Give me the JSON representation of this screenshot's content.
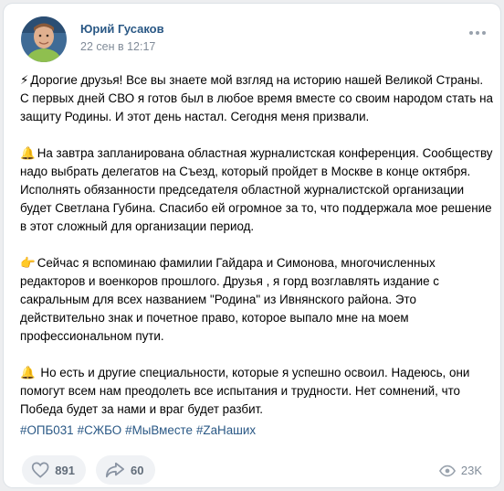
{
  "post": {
    "author": "Юрий Гусаков",
    "date": "22 сен в 12:17",
    "paragraphs": [
      {
        "icon": "⚡",
        "lines": [
          "Дорогие друзья! Все вы знаете мой взгляд на историю нашей Великой Страны.",
          "С первых дней СВО я готов был в любое время вместе со своим народом стать на",
          "защиту Родины. И этот день настал. Сегодня меня призвали."
        ]
      },
      {
        "icon": "🔔",
        "lines": [
          "На завтра запланирована областная журналистская конференция. Сообществу",
          "надо выбрать делегатов на Съезд, который пройдет в Москве в конце октября.",
          "Исполнять обязанности председателя областной журналистской организации",
          "будет Светлана Губина. Спасибо ей огромное за то, что поддержала мое решение",
          "в этот сложный для организации период."
        ]
      },
      {
        "icon": "👉",
        "lines": [
          "Сейчас я вспоминаю фамилии Гайдара и Симонова, многочисленных",
          "редакторов и военкоров прошлого. Друзья , я горд возглавлять издание с",
          "сакральным для всех названием \"Родина\" из Ивнянского района. Это",
          "действительно знак и почетное право, которое выпало мне на моем",
          "профессиональном пути."
        ]
      },
      {
        "icon": "🔔",
        "lines": [
          " Но есть и другие специальности, которые я успешно освоил. Надеюсь, они",
          "помогут всем нам преодолеть все испытания и трудности. Нет сомнений, что",
          "Победа будет за нами и враг будет разбит."
        ]
      }
    ],
    "hashtags": [
      "#ОПБ031",
      "#СЖБО",
      "#МыВместе",
      "#ZaНаших"
    ],
    "likes": "891",
    "shares": "60",
    "views": "23K"
  },
  "icons": {
    "like": "heart-icon",
    "share": "share-arrow-icon",
    "views": "eye-icon",
    "more": "more-dots-icon"
  },
  "colors": {
    "link": "#2a5885",
    "meta": "#818c99",
    "button_bg": "#f0f2f5",
    "page_bg": "#edeef0"
  }
}
